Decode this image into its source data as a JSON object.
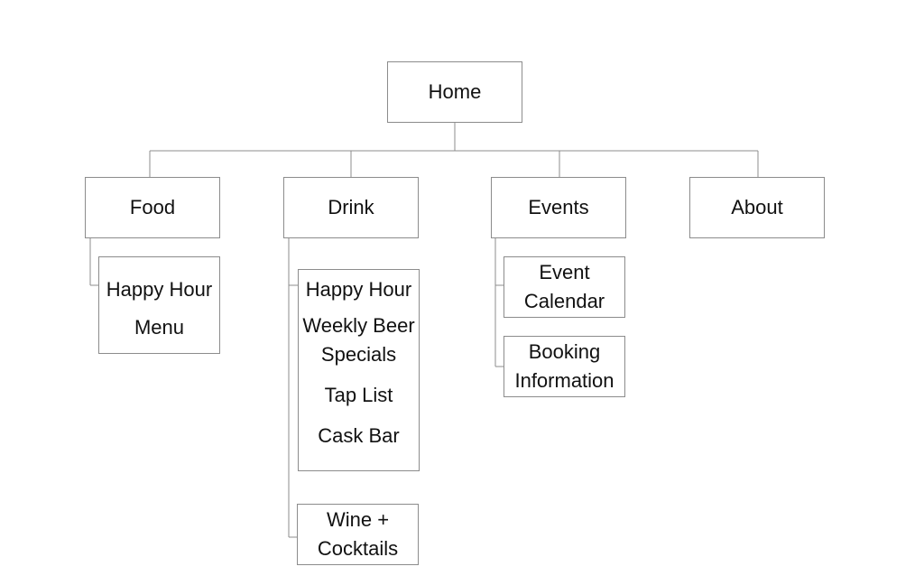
{
  "sitemap": {
    "root": {
      "label": "Home"
    },
    "sections": {
      "food": {
        "label": "Food",
        "children": [
          {
            "lines": [
              "Happy Hour",
              "Menu"
            ]
          }
        ]
      },
      "drink": {
        "label": "Drink",
        "children": [
          {
            "items": [
              "Happy Hour",
              "Weekly Beer Specials",
              "Tap List",
              "Cask Bar"
            ]
          },
          {
            "lines": [
              "Wine +",
              "Cocktails"
            ]
          }
        ]
      },
      "events": {
        "label": "Events",
        "children": [
          {
            "lines": [
              "Event",
              "Calendar"
            ]
          },
          {
            "lines": [
              "Booking",
              "Information"
            ]
          }
        ]
      },
      "about": {
        "label": "About"
      }
    }
  }
}
